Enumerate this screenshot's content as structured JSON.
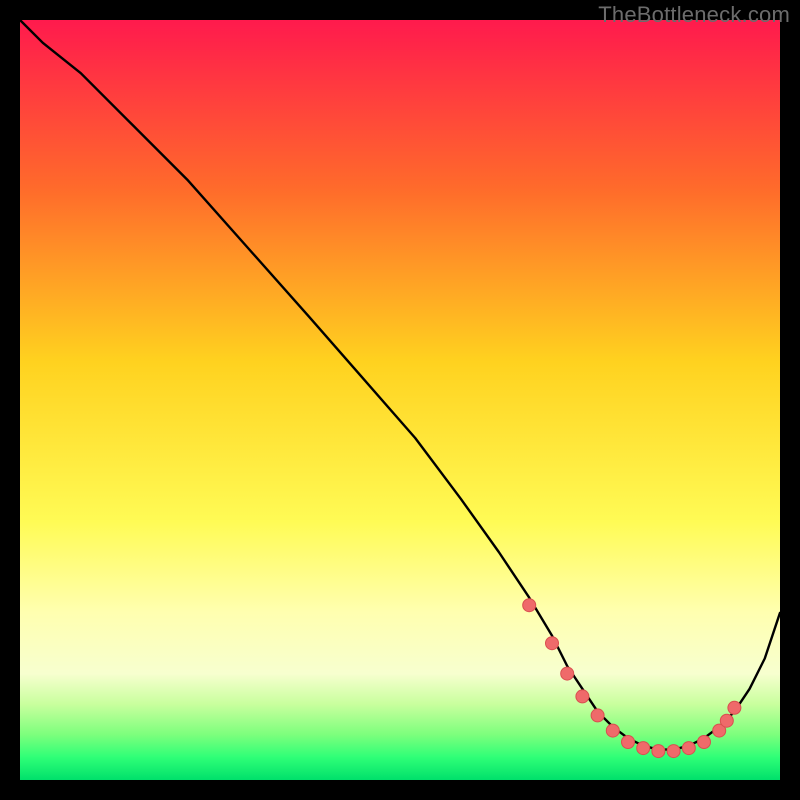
{
  "watermark": "TheBottleneck.com",
  "colors": {
    "bg_black": "#000000",
    "curve": "#000000",
    "marker_fill": "#ef6a6a",
    "marker_stroke": "#d94f4f",
    "grad_top": "#ff1a4d",
    "grad_mid1": "#ff6a2b",
    "grad_mid2": "#ffd21f",
    "grad_yellow": "#fffb55",
    "grad_paleyellow": "#ffffb0",
    "grad_cream": "#f7ffcf",
    "grad_lightgreen": "#c9ff9e",
    "grad_green1": "#7dff7d",
    "grad_green2": "#2fff77",
    "grad_bottom": "#00e06b"
  },
  "chart_data": {
    "type": "line",
    "title": "",
    "xlabel": "",
    "ylabel": "",
    "xlim": [
      0,
      100
    ],
    "ylim": [
      0,
      100
    ],
    "grid": false,
    "legend": false,
    "series": [
      {
        "name": "curve",
        "x": [
          0,
          3,
          8,
          15,
          22,
          30,
          38,
          45,
          52,
          58,
          63,
          67,
          70,
          72,
          74,
          76,
          78,
          80,
          82,
          84,
          86,
          88,
          90,
          92,
          94,
          96,
          98,
          100
        ],
        "y": [
          100,
          97,
          93,
          86,
          79,
          70,
          61,
          53,
          45,
          37,
          30,
          24,
          19,
          15,
          12,
          9,
          7,
          5.5,
          4.5,
          4,
          4,
          4.5,
          5.5,
          7,
          9,
          12,
          16,
          22
        ]
      }
    ],
    "markers": {
      "name": "highlight-points",
      "x": [
        67,
        70,
        72,
        74,
        76,
        78,
        80,
        82,
        84,
        86,
        88,
        90,
        92,
        93,
        94
      ],
      "y": [
        23,
        18,
        14,
        11,
        8.5,
        6.5,
        5,
        4.2,
        3.8,
        3.8,
        4.2,
        5,
        6.5,
        7.8,
        9.5
      ]
    }
  }
}
